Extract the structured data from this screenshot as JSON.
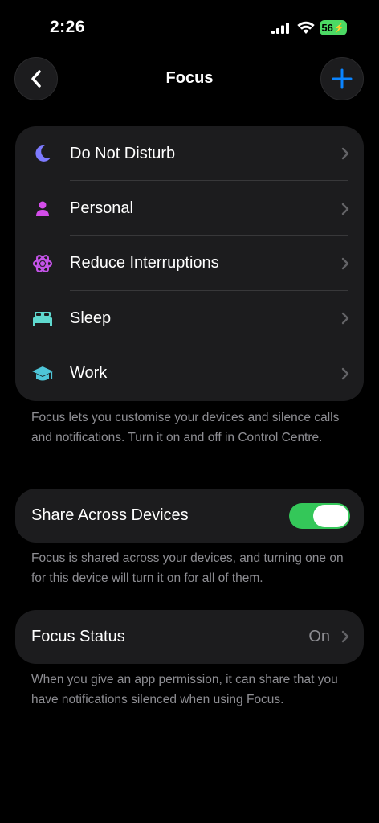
{
  "status_bar": {
    "time": "2:26",
    "battery": "56"
  },
  "nav": {
    "title": "Focus"
  },
  "focus_modes": [
    {
      "label": "Do Not Disturb",
      "icon": "moon-icon",
      "color": "#7d7aff"
    },
    {
      "label": "Personal",
      "icon": "person-icon",
      "color": "#d44dea"
    },
    {
      "label": "Reduce Interruptions",
      "icon": "reduce-interruptions-icon",
      "color": "#c453e8"
    },
    {
      "label": "Sleep",
      "icon": "bed-icon",
      "color": "#5fd9cf"
    },
    {
      "label": "Work",
      "icon": "graduation-cap-icon",
      "color": "#4ec5d8"
    }
  ],
  "focus_footnote": "Focus lets you customise your devices and silence calls and notifications. Turn it on and off in Control Centre.",
  "share": {
    "label": "Share Across Devices",
    "enabled": true
  },
  "share_footnote": "Focus is shared across your devices, and turning one on for this device will turn it on for all of them.",
  "focus_status": {
    "label": "Focus Status",
    "value": "On"
  },
  "status_footnote": "When you give an app permission, it can share that you have notifications silenced when using Focus.",
  "colors": {
    "accent": "#0a84ff",
    "toggle_on": "#34c759",
    "card": "#1c1c1e",
    "secondary_text": "#8e8e93"
  }
}
